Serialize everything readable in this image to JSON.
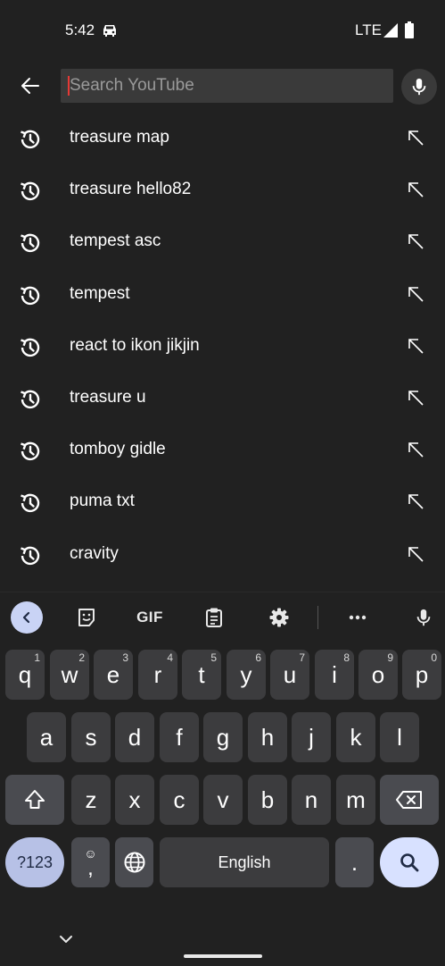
{
  "status_bar": {
    "time": "5:42",
    "network": "LTE"
  },
  "search": {
    "placeholder": "Search YouTube",
    "value": ""
  },
  "suggestions": [
    "treasure map",
    "treasure hello82",
    "tempest asc",
    "tempest",
    "react to ikon jikjin",
    "treasure u",
    "tomboy gidle",
    "puma txt",
    "cravity"
  ],
  "icons": {
    "back": "back-arrow-icon",
    "mic": "mic-icon",
    "history": "history-icon",
    "fill": "arrow-up-left-icon",
    "car": "car-icon",
    "signal": "signal-icon",
    "battery": "battery-icon"
  },
  "keyboard": {
    "toolbar": {
      "gif_label": "GIF"
    },
    "row1": [
      {
        "k": "q",
        "s": "1"
      },
      {
        "k": "w",
        "s": "2"
      },
      {
        "k": "e",
        "s": "3"
      },
      {
        "k": "r",
        "s": "4"
      },
      {
        "k": "t",
        "s": "5"
      },
      {
        "k": "y",
        "s": "6"
      },
      {
        "k": "u",
        "s": "7"
      },
      {
        "k": "i",
        "s": "8"
      },
      {
        "k": "o",
        "s": "9"
      },
      {
        "k": "p",
        "s": "0"
      }
    ],
    "row2": [
      "a",
      "s",
      "d",
      "f",
      "g",
      "h",
      "j",
      "k",
      "l"
    ],
    "row3": [
      "z",
      "x",
      "c",
      "v",
      "b",
      "n",
      "m"
    ],
    "symbols_label": "?123",
    "comma_label": ",",
    "emoji_label": "☺",
    "space_label": "English",
    "period_label": "."
  },
  "colors": {
    "background": "#212121",
    "search_field": "#3a3a3a",
    "caret": "#e53935",
    "key": "#3c3c3e",
    "accent_key": "#d8e1ff"
  }
}
